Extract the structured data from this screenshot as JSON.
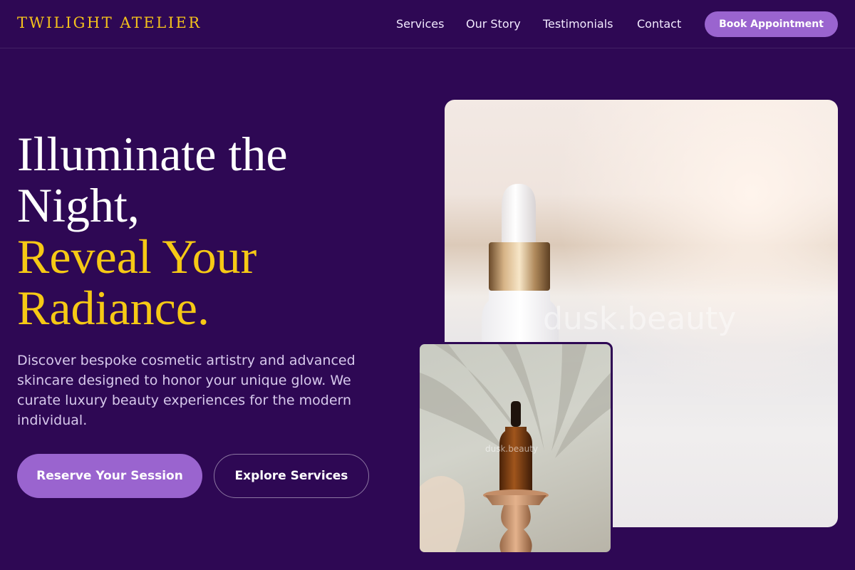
{
  "brand": "TWILIGHT ATELIER",
  "nav": {
    "links": [
      "Services",
      "Our Story",
      "Testimonials",
      "Contact"
    ],
    "cta": "Book Appointment"
  },
  "hero": {
    "headline_white_1": "Illuminate the",
    "headline_white_2": "Night,",
    "headline_gold_1": "Reveal Your",
    "headline_gold_2": "Radiance.",
    "lead": "Discover bespoke cosmetic artistry and advanced skincare designed to honor your unique glow. We curate luxury beauty experiences for the modern individual.",
    "primary_button": "Reserve Your Session",
    "secondary_button": "Explore Services"
  },
  "images": {
    "main_watermark": "dusk.beauty",
    "inset_watermark": "dusk.beauty"
  },
  "colors": {
    "background": "#2e0854",
    "accent_gold": "#f6c915",
    "accent_purple": "#9a64cf"
  }
}
